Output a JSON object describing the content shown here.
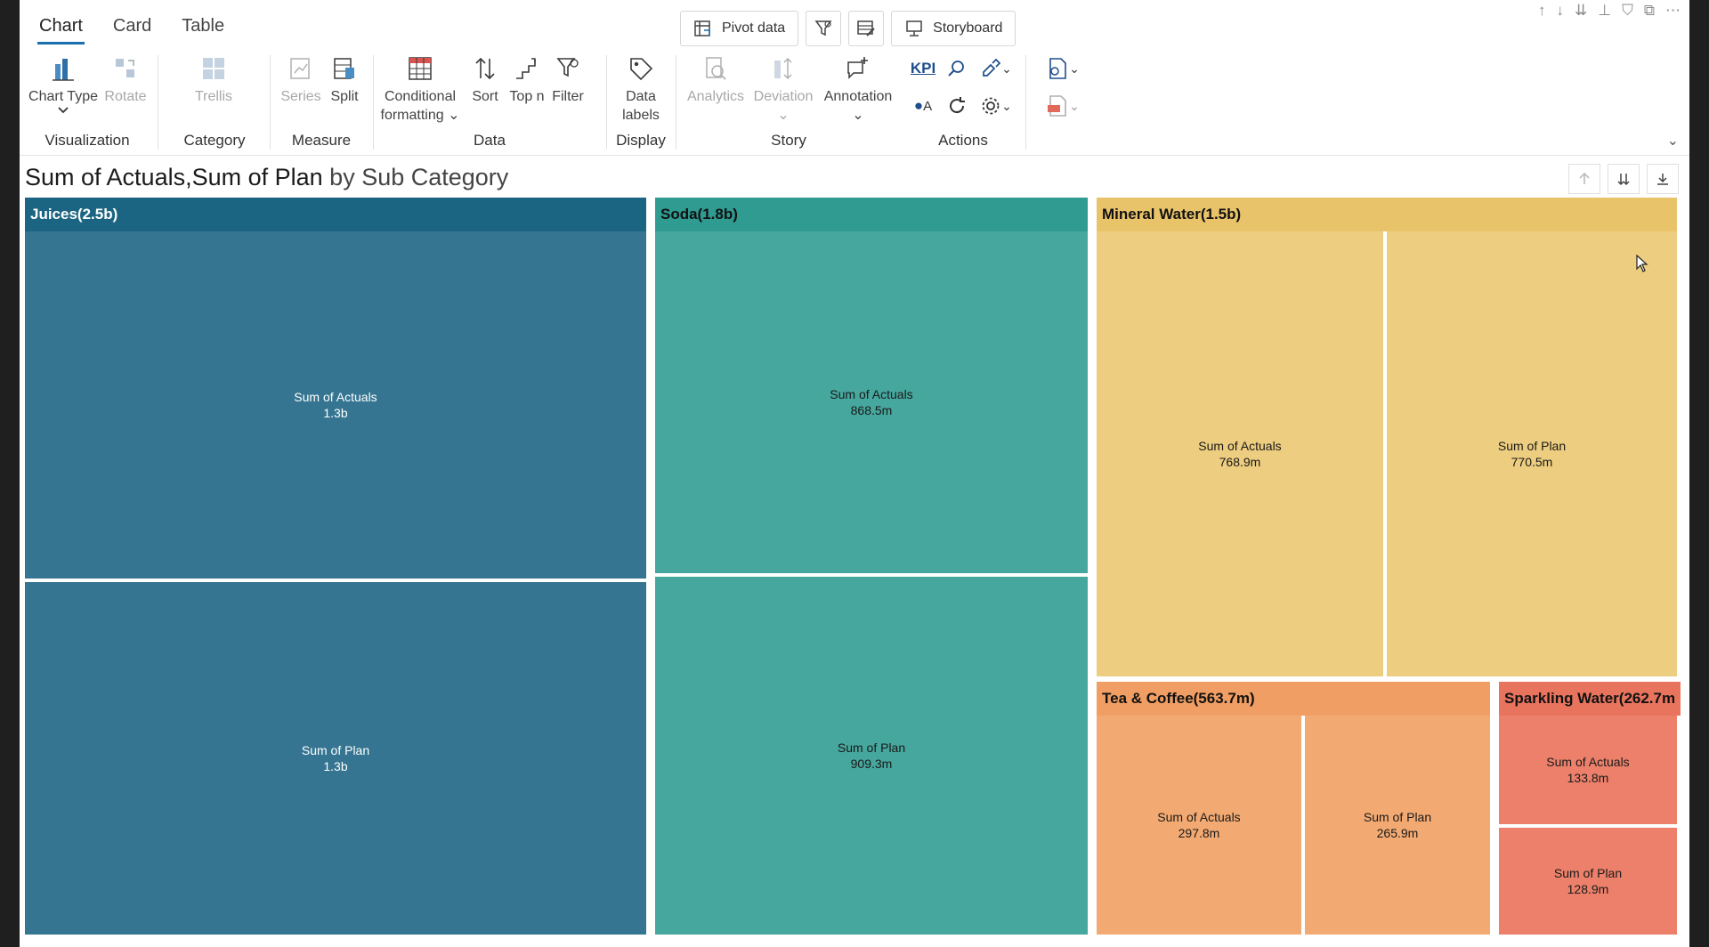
{
  "tabs": [
    "Chart",
    "Card",
    "Table"
  ],
  "active_tab": "Chart",
  "top_buttons": {
    "pivot": "Pivot data",
    "storyboard": "Storyboard"
  },
  "ribbon": {
    "visualization": {
      "label": "Visualization",
      "chart_type": "Chart Type",
      "rotate": "Rotate"
    },
    "category": {
      "label": "Category",
      "trellis": "Trellis"
    },
    "measure": {
      "label": "Measure",
      "series": "Series",
      "split": "Split"
    },
    "data": {
      "label": "Data",
      "conditional_line1": "Conditional",
      "conditional_line2": "formatting",
      "sort": "Sort",
      "topn": "Top n",
      "filter": "Filter"
    },
    "display": {
      "label": "Display",
      "data_labels_line1": "Data",
      "data_labels_line2": "labels"
    },
    "story": {
      "label": "Story",
      "analytics": "Analytics",
      "deviation": "Deviation",
      "annotation": "Annotation"
    },
    "actions": {
      "label": "Actions",
      "kpi": "KPI",
      "oa": "A"
    }
  },
  "title": {
    "measures": "Sum of Actuals,Sum of Plan",
    "by": " by Sub Category"
  },
  "colors": {
    "juices": "#357591",
    "juices_head": "#1b6582",
    "soda": "#46a79e",
    "soda_head": "#2f9b91",
    "mineral": "#edcd7f",
    "mineral_head": "#e9c36a",
    "tea": "#f3aa72",
    "tea_head": "#f09e63",
    "sparkling": "#ec806a",
    "sparkling_head": "#e9745e"
  },
  "treemap": {
    "juices": {
      "header": "Juices(2.5b)",
      "actuals_label": "Sum of Actuals",
      "actuals_value": "1.3b",
      "plan_label": "Sum of Plan",
      "plan_value": "1.3b"
    },
    "soda": {
      "header": "Soda(1.8b)",
      "actuals_label": "Sum of Actuals",
      "actuals_value": "868.5m",
      "plan_label": "Sum of Plan",
      "plan_value": "909.3m"
    },
    "mineral": {
      "header": "Mineral Water(1.5b)",
      "actuals_label": "Sum of Actuals",
      "actuals_value": "768.9m",
      "plan_label": "Sum of Plan",
      "plan_value": "770.5m"
    },
    "tea": {
      "header": "Tea & Coffee(563.7m)",
      "actuals_label": "Sum of Actuals",
      "actuals_value": "297.8m",
      "plan_label": "Sum of Plan",
      "plan_value": "265.9m"
    },
    "sparkling": {
      "header": "Sparkling Water(262.7m",
      "actuals_label": "Sum of Actuals",
      "actuals_value": "133.8m",
      "plan_label": "Sum of Plan",
      "plan_value": "128.9m"
    }
  }
}
